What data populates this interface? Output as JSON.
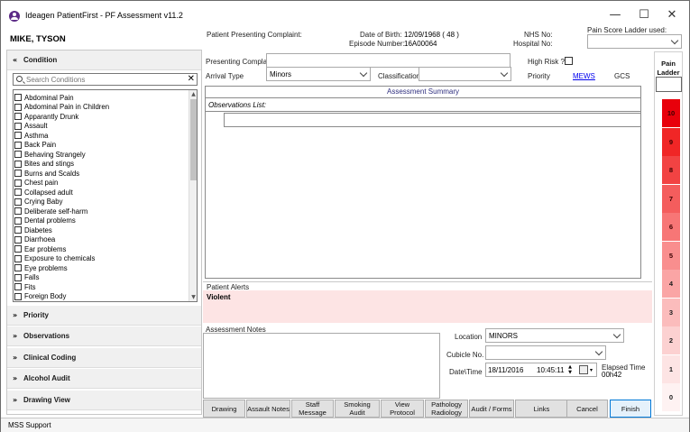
{
  "titlebar": {
    "title": "Ideagen PatientFirst - PF Assessment v11.2",
    "minimize": "—",
    "maximize": "☐",
    "close": "✕"
  },
  "patient": {
    "name": "MIKE,  TYSON",
    "presenting_complaint_label": "Patient Presenting Complaint:",
    "dob_label": "Date of Birth:",
    "dob_value": "12/09/1968 ( 48 )",
    "episode_label": "Episode Number:",
    "episode_value": "16A00064",
    "nhs_label": "NHS No:",
    "hospital_label": "Hospital No:",
    "pain_score_ladder_label": "Pain Score Ladder used:"
  },
  "left_panel": {
    "condition_header": "Condition",
    "search_placeholder": "Search Conditions",
    "conditions": [
      "Abdominal Pain",
      "Abdominal Pain in Children",
      "Apparantly Drunk",
      "Assault",
      "Asthma",
      "Back Pain",
      "Behaving Strangely",
      "Bites and stings",
      "Burns and Scalds",
      "Chest pain",
      "Collapsed adult",
      "Crying Baby",
      "Deliberate self-harm",
      "Dental problems",
      "Diabetes",
      "Diarrhoea",
      "Ear problems",
      "Exposure to chemicals",
      "Eye problems",
      "Falls",
      "Fits",
      "Foreign Body"
    ],
    "sections": [
      "Priority",
      "Observations",
      "Clinical Coding",
      "Alcohol Audit",
      "Drawing View"
    ]
  },
  "form": {
    "presenting_complaint_label": "Presenting Complaint",
    "high_risk_label": "High Risk ?",
    "arrival_type_label": "Arrival Type",
    "arrival_type_value": "Minors",
    "classification_label": "Classification",
    "priority_label": "Priority",
    "mews_label": "MEWS",
    "gcs_label": "GCS"
  },
  "summary": {
    "title": "Assessment  Summary",
    "observations_label": "Observations List:"
  },
  "alerts": {
    "label": "Patient Alerts",
    "value": "Violent"
  },
  "notes": {
    "label": "Assessment Notes"
  },
  "location": {
    "location_label": "Location",
    "location_value": "MINORS",
    "cubicle_label": "Cubicle No.",
    "datetime_label": "Date\\Time",
    "date_value": "18/11/2016",
    "time_value": "10:45:11",
    "elapsed_label": "Elapsed Time",
    "elapsed_value": "00h42"
  },
  "buttons": {
    "drawing": "Drawing",
    "assault_notes": "Assault Notes",
    "staff_message": "Staff Message",
    "smoking_audit": "Smoking Audit",
    "view_protocol": "View Protocol",
    "pathology_radiology": "Pathology Radiology",
    "audit_forms": "Audit / Forms",
    "links": "Links",
    "cancel": "Cancel",
    "finish": "Finish"
  },
  "pain_ladder": {
    "header": "Pain Ladder",
    "levels": [
      "10",
      "9",
      "8",
      "7",
      "6",
      "5",
      "4",
      "3",
      "2",
      "1",
      "0"
    ],
    "colors": [
      "#e8000b",
      "#f02626",
      "#f24343",
      "#f45d5d",
      "#f77676",
      "#f98e8e",
      "#faa5a5",
      "#fbbcbc",
      "#fcd1d1",
      "#fde4e4",
      "#fef2f2"
    ]
  },
  "statusbar": {
    "text": "MSS Support"
  }
}
